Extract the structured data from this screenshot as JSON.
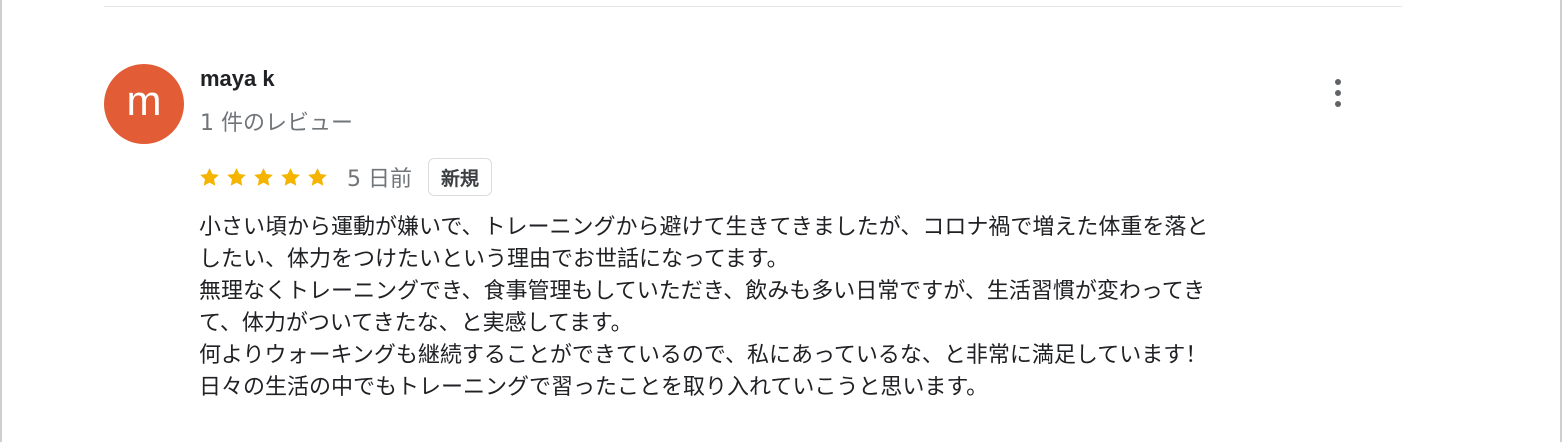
{
  "review": {
    "author": {
      "avatar_letter": "m",
      "avatar_color": "#e25d36",
      "name": "maya k",
      "review_count_text": "1 件のレビュー"
    },
    "more_options_icon": "more-vert-icon",
    "rating": 5,
    "rating_max": 5,
    "star_color": "#f4b400",
    "time_text": "5 日前",
    "badge_text": "新規",
    "body_lines": [
      "小さい頃から運動が嫌いで、トレーニングから避けて生きてきましたが、コロナ禍で増えた体重を落と",
      "したい、体力をつけたいという理由でお世話になってます。",
      "無理なくトレーニングでき、食事管理もしていただき、飲みも多い日常ですが、生活習慣が変わってき",
      "て、体力がついてきたな、と実感してます。",
      "何よりウォーキングも継続することができているので、私にあっているな、と非常に満足しています！",
      "日々の生活の中でもトレーニングで習ったことを取り入れていこうと思います。"
    ]
  }
}
